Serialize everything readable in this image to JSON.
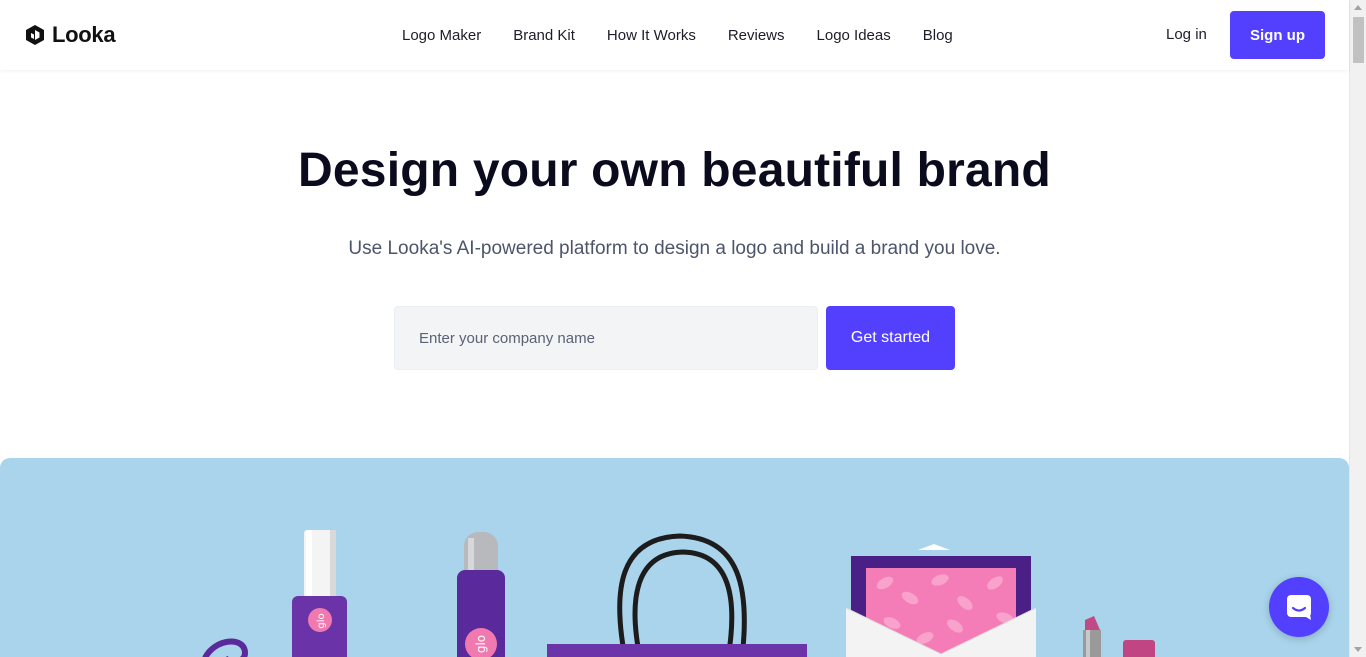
{
  "header": {
    "brand": "Looka",
    "nav": [
      {
        "label": "Logo Maker"
      },
      {
        "label": "Brand Kit"
      },
      {
        "label": "How It Works"
      },
      {
        "label": "Reviews"
      },
      {
        "label": "Logo Ideas"
      },
      {
        "label": "Blog"
      }
    ],
    "login_label": "Log in",
    "signup_label": "Sign up"
  },
  "hero": {
    "title": "Design your own beautiful brand",
    "subtitle": "Use Looka's AI-powered platform to design a logo and build a brand you love.",
    "input_placeholder": "Enter your company name",
    "cta_label": "Get started"
  },
  "banner": {
    "products": [
      "nail-polish",
      "spray-bottle",
      "shopping-bag",
      "envelope",
      "lipstick"
    ],
    "product_logo_text": "glo"
  },
  "colors": {
    "accent": "#5340ff",
    "banner_bg": "#a9d4eb",
    "product_purple": "#5a2a9c",
    "product_pink": "#f07ab0"
  },
  "icons": {
    "logo": "looka-hexagon-icon",
    "chat": "chat-smile-icon"
  }
}
